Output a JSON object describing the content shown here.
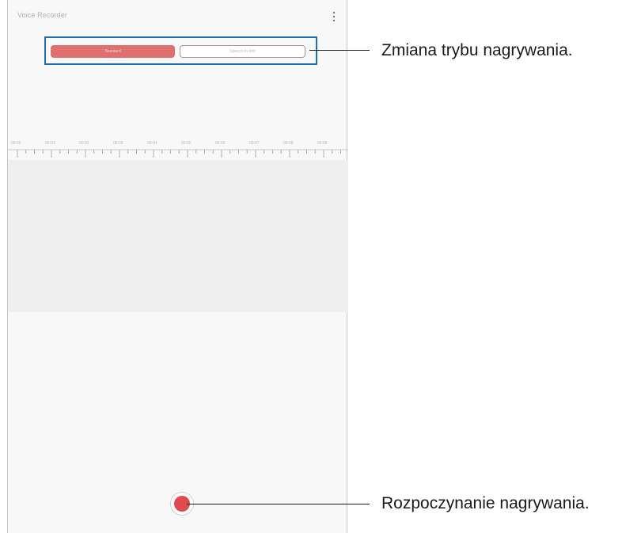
{
  "app": {
    "title": "Voice Recorder"
  },
  "modes": {
    "active_label": "Standard",
    "inactive_label": "Speech-to-text"
  },
  "timeline": {
    "labels": [
      "00:00",
      "00:01",
      "00:02",
      "00:03",
      "00:04",
      "00:05",
      "00:06",
      "00:07",
      "00:08",
      "00:09"
    ]
  },
  "callouts": {
    "mode_change": "Zmiana trybu nagrywania.",
    "start_recording": "Rozpoczynanie nagrywania."
  },
  "colors": {
    "record": "#e04a4f",
    "active_tab": "#e07070",
    "highlight": "#1f6fb3"
  }
}
